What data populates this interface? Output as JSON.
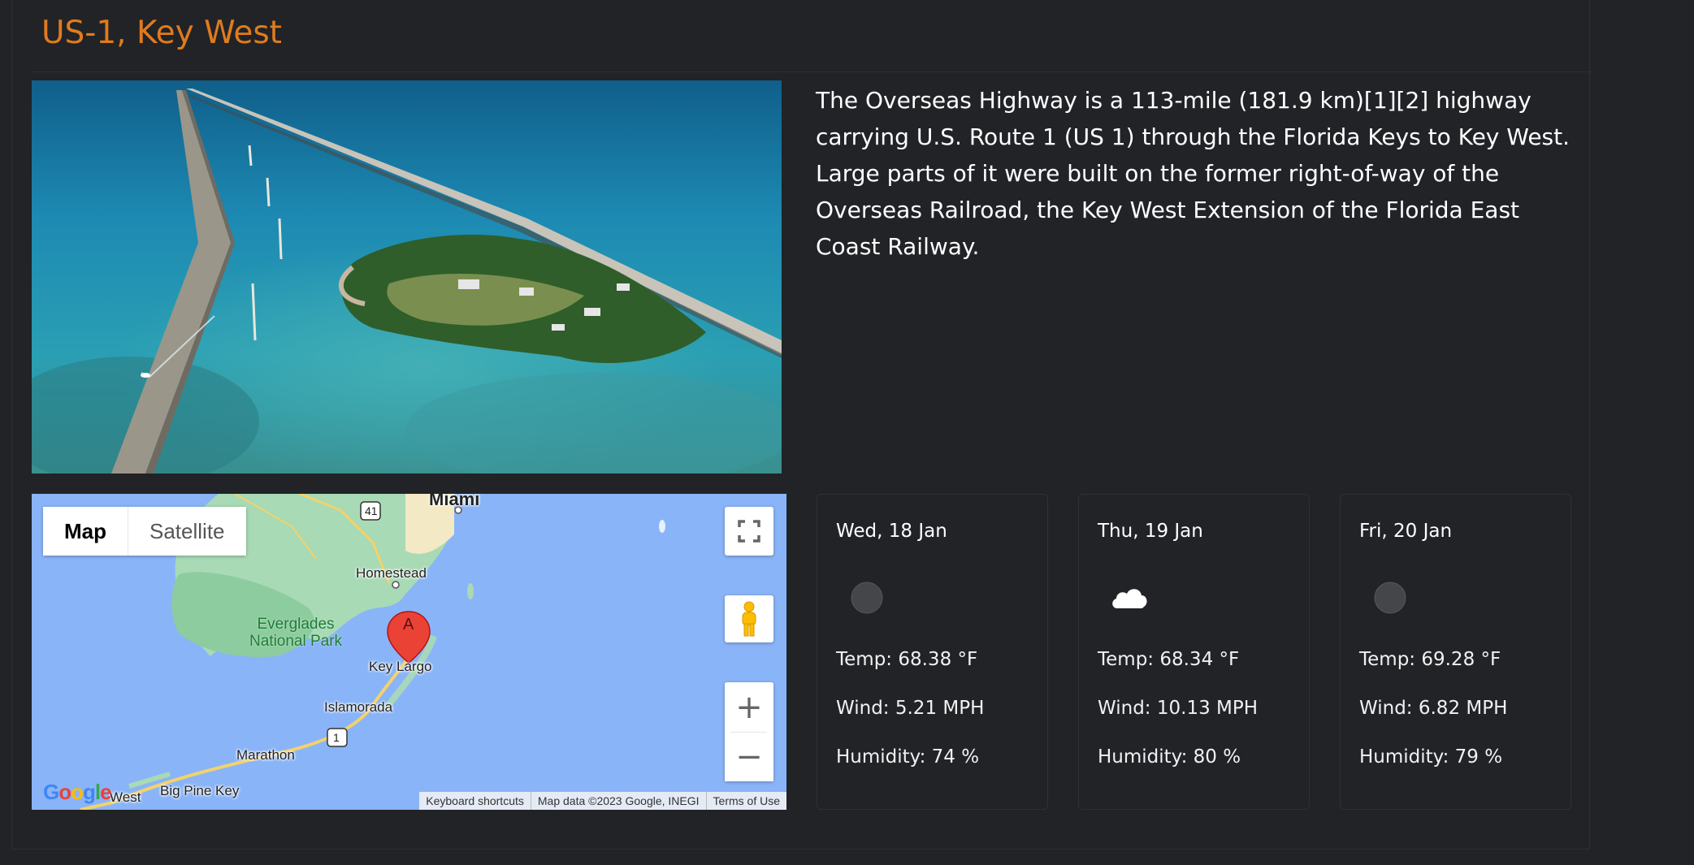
{
  "header": {
    "title": "US-1, Key West"
  },
  "description": "The Overseas Highway is a 113-mile (181.9 km)[1][2] highway carrying U.S. Route 1 (US 1) through the Florida Keys to Key West. Large parts of it were built on the former right-of-way of the Overseas Railroad, the Key West Extension of the Florida East Coast Railway.",
  "map": {
    "type_buttons": {
      "map": "Map",
      "satellite": "Satellite"
    },
    "labels": {
      "miami": "Miami",
      "homestead": "Homestead",
      "park_line1": "Everglades",
      "park_line2": "National Park",
      "key_largo": "Key Largo",
      "islamorada": "Islamorada",
      "marathon": "Marathon",
      "big_pine_key": "Big Pine Key",
      "key_west_partial": "West",
      "route_41": "41",
      "route_1": "1",
      "marker": "A"
    },
    "footer": {
      "shortcuts": "Keyboard shortcuts",
      "data": "Map data ©2023 Google, INEGI",
      "terms": "Terms of Use"
    },
    "logo": "Google",
    "zoom_in": "+",
    "zoom_out": "−"
  },
  "forecast": [
    {
      "date": "Wed, 18 Jan",
      "icon": "clear-night-icon",
      "temp": "Temp: 68.38 °F",
      "wind": "Wind: 5.21 MPH",
      "humidity": "Humidity: 74 %"
    },
    {
      "date": "Thu, 19 Jan",
      "icon": "cloud-icon",
      "temp": "Temp: 68.34 °F",
      "wind": "Wind: 10.13 MPH",
      "humidity": "Humidity: 80 %"
    },
    {
      "date": "Fri, 20 Jan",
      "icon": "clear-night-icon",
      "temp": "Temp: 69.28 °F",
      "wind": "Wind: 6.82 MPH",
      "humidity": "Humidity: 79 %"
    }
  ],
  "colors": {
    "accent": "#e07b1d",
    "background": "#212327",
    "water": "#8ab4f8",
    "land": "#a8dab5"
  }
}
